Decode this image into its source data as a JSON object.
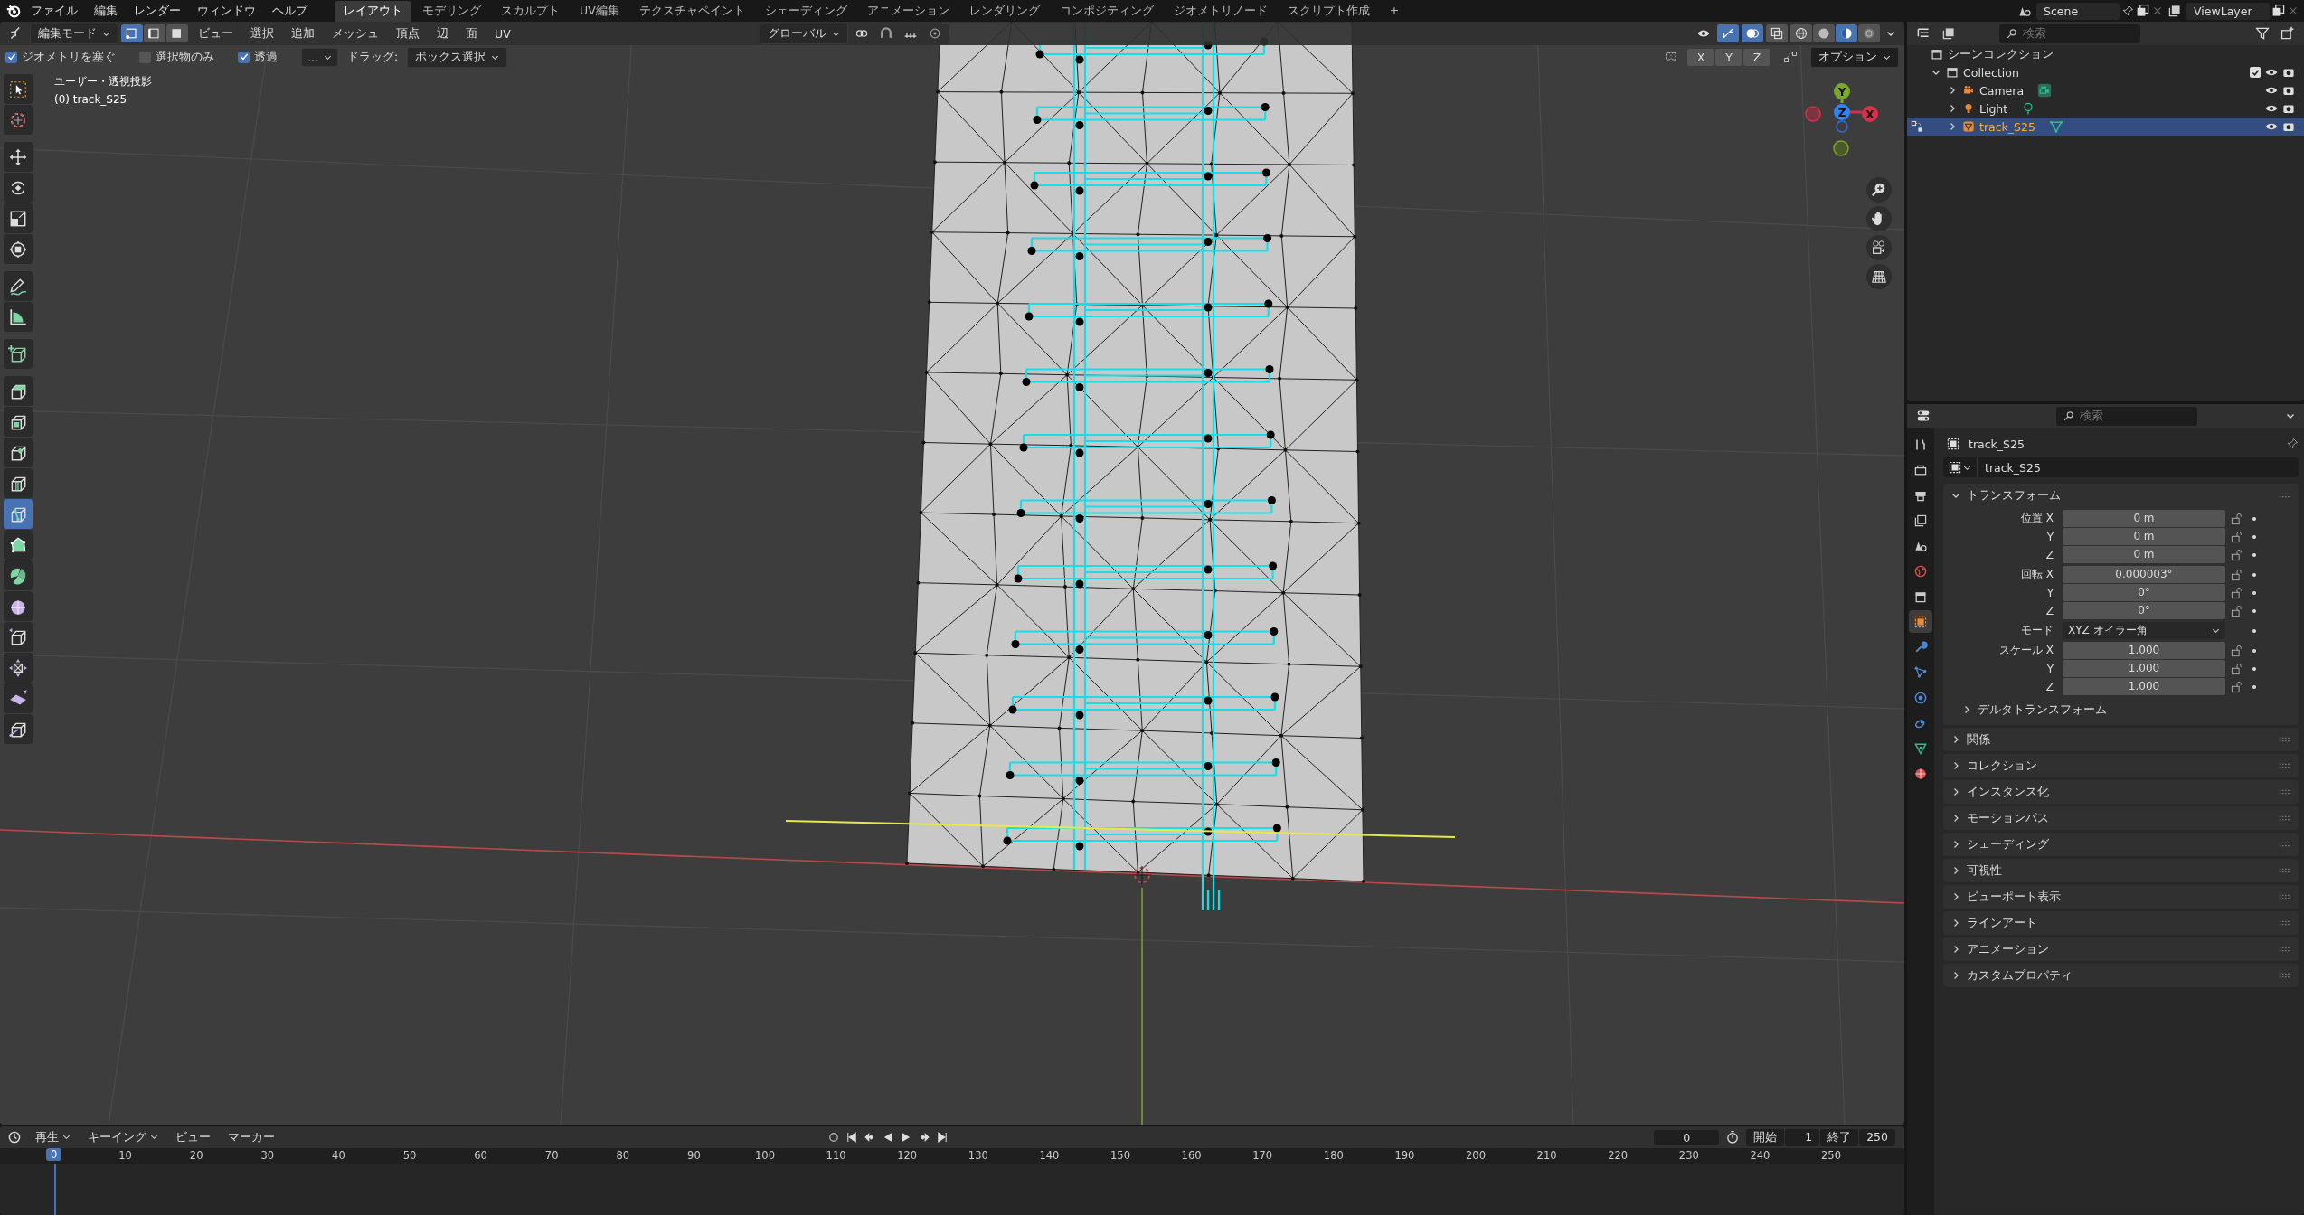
{
  "top_bar": {
    "menus": [
      "ファイル",
      "編集",
      "レンダー",
      "ウィンドウ",
      "ヘルプ"
    ],
    "workspaces": [
      {
        "label": "レイアウト",
        "selected": true
      },
      {
        "label": "モデリング",
        "selected": false
      },
      {
        "label": "スカルプト",
        "selected": false
      },
      {
        "label": "UV編集",
        "selected": false
      },
      {
        "label": "テクスチャペイント",
        "selected": false
      },
      {
        "label": "シェーディング",
        "selected": false
      },
      {
        "label": "アニメーション",
        "selected": false
      },
      {
        "label": "レンダリング",
        "selected": false
      },
      {
        "label": "コンポジティング",
        "selected": false
      },
      {
        "label": "ジオメトリノード",
        "selected": false
      },
      {
        "label": "スクリプト作成",
        "selected": false
      }
    ],
    "add_tab": "+",
    "scene": "Scene",
    "view_layer": "ViewLayer"
  },
  "viewport_header": {
    "mode": "編集モード",
    "select_modes": [
      {
        "kind": "vertex",
        "selected": true
      },
      {
        "kind": "edge",
        "selected": false
      },
      {
        "kind": "face",
        "selected": false
      }
    ],
    "menus": [
      "ビュー",
      "選択",
      "追加",
      "メッシュ",
      "頂点",
      "辺",
      "面",
      "UV"
    ],
    "orientation": "グローバル",
    "toggles": [
      {
        "kind": "gizmo",
        "on": true
      },
      {
        "kind": "overlay",
        "on": true
      },
      {
        "kind": "xray",
        "on": false
      }
    ],
    "shading_modes": [
      {
        "kind": "wireframe",
        "selected": false
      },
      {
        "kind": "solid",
        "selected": false
      },
      {
        "kind": "material",
        "selected": true
      },
      {
        "kind": "rendered",
        "selected": false
      }
    ]
  },
  "tool_settings": {
    "options": [
      {
        "label": "ジオメトリを塞ぐ",
        "checked": true
      },
      {
        "label": "選択物のみ",
        "checked": false
      },
      {
        "label": "透過",
        "checked": true
      }
    ],
    "more": "...",
    "drag_label": "ドラッグ:",
    "drag_value": "ボックス選択",
    "mirror_axes": [
      {
        "label": "X",
        "on": false
      },
      {
        "label": "Y",
        "on": false
      },
      {
        "label": "Z",
        "on": false
      }
    ],
    "options_menu": "オプション"
  },
  "viewport": {
    "view_name": "ユーザー・透視投影",
    "object_label": "(0) track_S25",
    "gizmo_axes": [
      "Y",
      "Z",
      "X"
    ]
  },
  "toolbar": [
    {
      "kind": "select",
      "selected": false
    },
    {
      "kind": "cursor",
      "selected": false
    },
    {
      "kind": "move",
      "selected": false
    },
    {
      "kind": "rotate",
      "selected": false
    },
    {
      "kind": "scale",
      "selected": false
    },
    {
      "kind": "transform",
      "selected": false
    },
    {
      "kind": "annotate",
      "selected": false
    },
    {
      "kind": "measure",
      "selected": false
    },
    {
      "kind": "add_cube",
      "selected": false
    },
    {
      "kind": "extrude",
      "selected": false
    },
    {
      "kind": "inset",
      "selected": false
    },
    {
      "kind": "bevel",
      "selected": false
    },
    {
      "kind": "loop_cut",
      "selected": false
    },
    {
      "kind": "knife",
      "selected": true
    },
    {
      "kind": "poly_build",
      "selected": false
    },
    {
      "kind": "spin",
      "selected": false
    },
    {
      "kind": "smooth",
      "selected": false
    },
    {
      "kind": "edge_slide",
      "selected": false
    },
    {
      "kind": "shrink",
      "selected": false
    },
    {
      "kind": "shear",
      "selected": false
    },
    {
      "kind": "rip",
      "selected": false
    }
  ],
  "outliner": {
    "search_placeholder": "検索",
    "root": "シーンコレクション",
    "collections": [
      {
        "name": "Collection",
        "checked": true,
        "expanded": true,
        "children": [
          {
            "name": "Camera",
            "kind": "camera",
            "expanded": false,
            "selected": false
          },
          {
            "name": "Light",
            "kind": "light",
            "expanded": false,
            "selected": false
          },
          {
            "name": "track_S25",
            "kind": "mesh",
            "expanded": false,
            "selected": true
          }
        ]
      }
    ]
  },
  "properties": {
    "search_placeholder": "検索",
    "tabs": [
      {
        "kind": "tool",
        "selected": false
      },
      {
        "kind": "render",
        "selected": false
      },
      {
        "kind": "output",
        "selected": false
      },
      {
        "kind": "view_layer",
        "selected": false
      },
      {
        "kind": "scene",
        "selected": false
      },
      {
        "kind": "world",
        "selected": false
      },
      {
        "kind": "collection",
        "selected": false
      },
      {
        "kind": "object",
        "selected": true
      },
      {
        "kind": "modifiers",
        "selected": false
      },
      {
        "kind": "particles",
        "selected": false
      },
      {
        "kind": "physics",
        "selected": false
      },
      {
        "kind": "constraints",
        "selected": false
      },
      {
        "kind": "data",
        "selected": false
      },
      {
        "kind": "material",
        "selected": false
      }
    ],
    "object_name": "track_S25",
    "data_name": "track_S25",
    "transform": {
      "title": "トランスフォーム",
      "expanded": true,
      "rows": [
        {
          "kind": "vector",
          "fields": [
            {
              "label": "位置 X",
              "value": "0 m"
            },
            {
              "label": "Y",
              "value": "0 m"
            },
            {
              "label": "Z",
              "value": "0 m"
            }
          ]
        },
        {
          "kind": "vector",
          "fields": [
            {
              "label": "回転 X",
              "value": "0.000003°"
            },
            {
              "label": "Y",
              "value": "0°"
            },
            {
              "label": "Z",
              "value": "0°"
            }
          ]
        },
        {
          "kind": "dropdown",
          "label": "モード",
          "value": "XYZ オイラー角"
        },
        {
          "kind": "vector",
          "fields": [
            {
              "label": "スケール X",
              "value": "1.000"
            },
            {
              "label": "Y",
              "value": "1.000"
            },
            {
              "label": "Z",
              "value": "1.000"
            }
          ]
        }
      ],
      "sub_panel": {
        "title": "デルタトランスフォーム",
        "expanded": false
      }
    },
    "panels": [
      {
        "title": "関係",
        "expanded": false
      },
      {
        "title": "コレクション",
        "expanded": false
      },
      {
        "title": "インスタンス化",
        "expanded": false
      },
      {
        "title": "モーションパス",
        "expanded": false
      },
      {
        "title": "シェーディング",
        "expanded": false
      },
      {
        "title": "可視性",
        "expanded": false
      },
      {
        "title": "ビューポート表示",
        "expanded": false
      },
      {
        "title": "ラインアート",
        "expanded": false
      },
      {
        "title": "アニメーション",
        "expanded": false
      },
      {
        "title": "カスタムプロパティ",
        "expanded": false
      }
    ]
  },
  "timeline": {
    "menus": [
      {
        "label": "再生",
        "dropdown": true
      },
      {
        "label": "キーイング",
        "dropdown": true
      },
      {
        "label": "ビュー",
        "dropdown": false
      },
      {
        "label": "マーカー",
        "dropdown": false
      }
    ],
    "current_frame": "0",
    "start_label": "開始",
    "start": "1",
    "end_label": "終了",
    "end": "250",
    "playhead": "0",
    "ruler": [
      "10",
      "20",
      "30",
      "40",
      "50",
      "60",
      "70",
      "80",
      "90",
      "100",
      "110",
      "120",
      "130",
      "140",
      "150",
      "160",
      "170",
      "180",
      "190",
      "200",
      "210",
      "220",
      "230",
      "240",
      "250"
    ]
  }
}
